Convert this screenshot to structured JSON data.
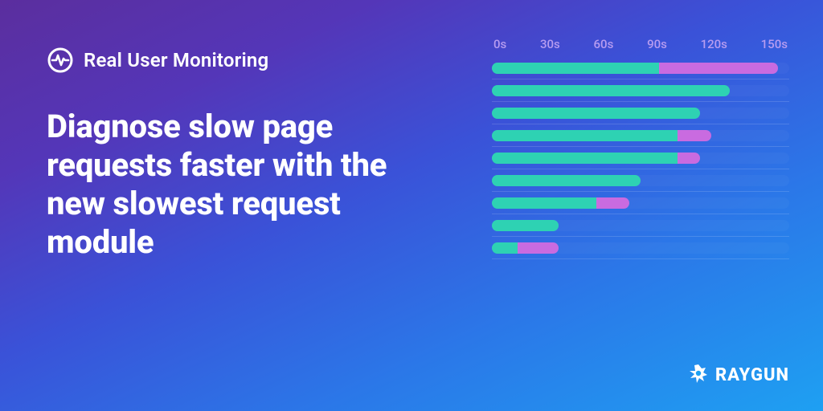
{
  "product": {
    "name": "Real User Monitoring",
    "icon": "pulse-circle-icon"
  },
  "headline": "Diagnose slow page requests faster with the new slowest request module",
  "brand": {
    "name": "RAYGUN",
    "icon": "raygun-icon"
  },
  "colors": {
    "teal": "#2ed2b3",
    "magenta": "#c96be0",
    "axis_text": "#b79cf0"
  },
  "chart_data": {
    "type": "bar",
    "orientation": "horizontal",
    "title": "",
    "xlabel": "",
    "ylabel": "",
    "xlim": [
      0,
      160
    ],
    "x_ticks": [
      "0s",
      "30s",
      "60s",
      "90s",
      "120s",
      "150s"
    ],
    "series_names": [
      "teal",
      "magenta"
    ],
    "rows": [
      {
        "segments": [
          {
            "series": "teal",
            "start": 0,
            "end": 90
          },
          {
            "series": "magenta",
            "start": 90,
            "end": 154
          }
        ]
      },
      {
        "segments": [
          {
            "series": "teal",
            "start": 0,
            "end": 128
          }
        ]
      },
      {
        "segments": [
          {
            "series": "teal",
            "start": 0,
            "end": 112
          }
        ]
      },
      {
        "segments": [
          {
            "series": "teal",
            "start": 0,
            "end": 100
          },
          {
            "series": "magenta",
            "start": 100,
            "end": 118
          }
        ]
      },
      {
        "segments": [
          {
            "series": "teal",
            "start": 0,
            "end": 100
          },
          {
            "series": "magenta",
            "start": 100,
            "end": 112
          }
        ]
      },
      {
        "segments": [
          {
            "series": "teal",
            "start": 0,
            "end": 80
          }
        ]
      },
      {
        "segments": [
          {
            "series": "teal",
            "start": 0,
            "end": 56
          },
          {
            "series": "magenta",
            "start": 56,
            "end": 74
          }
        ]
      },
      {
        "segments": [
          {
            "series": "teal",
            "start": 0,
            "end": 36
          }
        ]
      },
      {
        "segments": [
          {
            "series": "teal",
            "start": 0,
            "end": 14
          },
          {
            "series": "magenta",
            "start": 14,
            "end": 36
          }
        ]
      }
    ]
  }
}
